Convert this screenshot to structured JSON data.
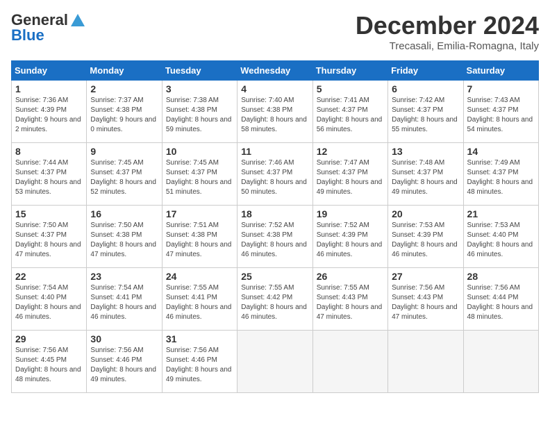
{
  "header": {
    "logo_general": "General",
    "logo_blue": "Blue",
    "month_title": "December 2024",
    "subtitle": "Trecasali, Emilia-Romagna, Italy"
  },
  "days_of_week": [
    "Sunday",
    "Monday",
    "Tuesday",
    "Wednesday",
    "Thursday",
    "Friday",
    "Saturday"
  ],
  "weeks": [
    [
      {
        "day": 1,
        "sunrise": "Sunrise: 7:36 AM",
        "sunset": "Sunset: 4:39 PM",
        "daylight": "Daylight: 9 hours and 2 minutes."
      },
      {
        "day": 2,
        "sunrise": "Sunrise: 7:37 AM",
        "sunset": "Sunset: 4:38 PM",
        "daylight": "Daylight: 9 hours and 0 minutes."
      },
      {
        "day": 3,
        "sunrise": "Sunrise: 7:38 AM",
        "sunset": "Sunset: 4:38 PM",
        "daylight": "Daylight: 8 hours and 59 minutes."
      },
      {
        "day": 4,
        "sunrise": "Sunrise: 7:40 AM",
        "sunset": "Sunset: 4:38 PM",
        "daylight": "Daylight: 8 hours and 58 minutes."
      },
      {
        "day": 5,
        "sunrise": "Sunrise: 7:41 AM",
        "sunset": "Sunset: 4:37 PM",
        "daylight": "Daylight: 8 hours and 56 minutes."
      },
      {
        "day": 6,
        "sunrise": "Sunrise: 7:42 AM",
        "sunset": "Sunset: 4:37 PM",
        "daylight": "Daylight: 8 hours and 55 minutes."
      },
      {
        "day": 7,
        "sunrise": "Sunrise: 7:43 AM",
        "sunset": "Sunset: 4:37 PM",
        "daylight": "Daylight: 8 hours and 54 minutes."
      }
    ],
    [
      {
        "day": 8,
        "sunrise": "Sunrise: 7:44 AM",
        "sunset": "Sunset: 4:37 PM",
        "daylight": "Daylight: 8 hours and 53 minutes."
      },
      {
        "day": 9,
        "sunrise": "Sunrise: 7:45 AM",
        "sunset": "Sunset: 4:37 PM",
        "daylight": "Daylight: 8 hours and 52 minutes."
      },
      {
        "day": 10,
        "sunrise": "Sunrise: 7:45 AM",
        "sunset": "Sunset: 4:37 PM",
        "daylight": "Daylight: 8 hours and 51 minutes."
      },
      {
        "day": 11,
        "sunrise": "Sunrise: 7:46 AM",
        "sunset": "Sunset: 4:37 PM",
        "daylight": "Daylight: 8 hours and 50 minutes."
      },
      {
        "day": 12,
        "sunrise": "Sunrise: 7:47 AM",
        "sunset": "Sunset: 4:37 PM",
        "daylight": "Daylight: 8 hours and 49 minutes."
      },
      {
        "day": 13,
        "sunrise": "Sunrise: 7:48 AM",
        "sunset": "Sunset: 4:37 PM",
        "daylight": "Daylight: 8 hours and 49 minutes."
      },
      {
        "day": 14,
        "sunrise": "Sunrise: 7:49 AM",
        "sunset": "Sunset: 4:37 PM",
        "daylight": "Daylight: 8 hours and 48 minutes."
      }
    ],
    [
      {
        "day": 15,
        "sunrise": "Sunrise: 7:50 AM",
        "sunset": "Sunset: 4:37 PM",
        "daylight": "Daylight: 8 hours and 47 minutes."
      },
      {
        "day": 16,
        "sunrise": "Sunrise: 7:50 AM",
        "sunset": "Sunset: 4:38 PM",
        "daylight": "Daylight: 8 hours and 47 minutes."
      },
      {
        "day": 17,
        "sunrise": "Sunrise: 7:51 AM",
        "sunset": "Sunset: 4:38 PM",
        "daylight": "Daylight: 8 hours and 47 minutes."
      },
      {
        "day": 18,
        "sunrise": "Sunrise: 7:52 AM",
        "sunset": "Sunset: 4:38 PM",
        "daylight": "Daylight: 8 hours and 46 minutes."
      },
      {
        "day": 19,
        "sunrise": "Sunrise: 7:52 AM",
        "sunset": "Sunset: 4:39 PM",
        "daylight": "Daylight: 8 hours and 46 minutes."
      },
      {
        "day": 20,
        "sunrise": "Sunrise: 7:53 AM",
        "sunset": "Sunset: 4:39 PM",
        "daylight": "Daylight: 8 hours and 46 minutes."
      },
      {
        "day": 21,
        "sunrise": "Sunrise: 7:53 AM",
        "sunset": "Sunset: 4:40 PM",
        "daylight": "Daylight: 8 hours and 46 minutes."
      }
    ],
    [
      {
        "day": 22,
        "sunrise": "Sunrise: 7:54 AM",
        "sunset": "Sunset: 4:40 PM",
        "daylight": "Daylight: 8 hours and 46 minutes."
      },
      {
        "day": 23,
        "sunrise": "Sunrise: 7:54 AM",
        "sunset": "Sunset: 4:41 PM",
        "daylight": "Daylight: 8 hours and 46 minutes."
      },
      {
        "day": 24,
        "sunrise": "Sunrise: 7:55 AM",
        "sunset": "Sunset: 4:41 PM",
        "daylight": "Daylight: 8 hours and 46 minutes."
      },
      {
        "day": 25,
        "sunrise": "Sunrise: 7:55 AM",
        "sunset": "Sunset: 4:42 PM",
        "daylight": "Daylight: 8 hours and 46 minutes."
      },
      {
        "day": 26,
        "sunrise": "Sunrise: 7:55 AM",
        "sunset": "Sunset: 4:43 PM",
        "daylight": "Daylight: 8 hours and 47 minutes."
      },
      {
        "day": 27,
        "sunrise": "Sunrise: 7:56 AM",
        "sunset": "Sunset: 4:43 PM",
        "daylight": "Daylight: 8 hours and 47 minutes."
      },
      {
        "day": 28,
        "sunrise": "Sunrise: 7:56 AM",
        "sunset": "Sunset: 4:44 PM",
        "daylight": "Daylight: 8 hours and 48 minutes."
      }
    ],
    [
      {
        "day": 29,
        "sunrise": "Sunrise: 7:56 AM",
        "sunset": "Sunset: 4:45 PM",
        "daylight": "Daylight: 8 hours and 48 minutes."
      },
      {
        "day": 30,
        "sunrise": "Sunrise: 7:56 AM",
        "sunset": "Sunset: 4:46 PM",
        "daylight": "Daylight: 8 hours and 49 minutes."
      },
      {
        "day": 31,
        "sunrise": "Sunrise: 7:56 AM",
        "sunset": "Sunset: 4:46 PM",
        "daylight": "Daylight: 8 hours and 49 minutes."
      },
      null,
      null,
      null,
      null
    ]
  ]
}
